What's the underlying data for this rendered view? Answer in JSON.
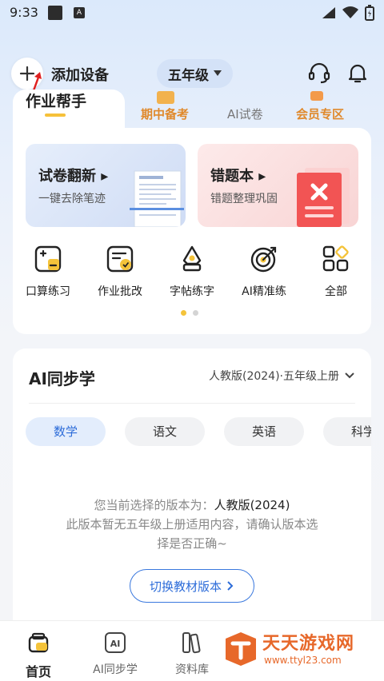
{
  "status": {
    "time": "9:33",
    "notif_letter": "A"
  },
  "header": {
    "add_label": "添加设备",
    "grade": "五年级"
  },
  "tabs": {
    "active": "作业帮手",
    "midterm": "期中备考",
    "ai_paper": "AI试卷",
    "vip": "会员专区"
  },
  "promos": [
    {
      "title": "试卷翻新",
      "subtitle": "一键去除笔迹"
    },
    {
      "title": "错题本",
      "subtitle": "错题整理巩固"
    }
  ],
  "quick": [
    {
      "label": "口算练习",
      "icon": "calc-icon"
    },
    {
      "label": "作业批改",
      "icon": "homework-check-icon"
    },
    {
      "label": "字帖练字",
      "icon": "brush-icon"
    },
    {
      "label": "AI精准练",
      "icon": "target-icon"
    },
    {
      "label": "全部",
      "icon": "all-grid-icon"
    }
  ],
  "sync": {
    "title": "AI同步学",
    "edition": "人教版(2024)·五年级上册",
    "subjects": [
      "数学",
      "语文",
      "英语",
      "科学"
    ],
    "notice_prefix": "您当前选择的版本为：",
    "notice_edition": "人教版(2024)",
    "notice_line2": "此版本暂无五年级上册适用内容，请确认版本选",
    "notice_line3": "择是否正确~",
    "switch_label": "切换教材版本"
  },
  "nav": [
    {
      "label": "首页",
      "active": true
    },
    {
      "label": "AI同步学",
      "active": false
    },
    {
      "label": "资料库",
      "active": false
    }
  ],
  "watermark": {
    "line1": "天天游戏网",
    "line2": "www.ttyl23.com"
  },
  "colors": {
    "accent_blue": "#2e6dd9",
    "accent_yellow": "#f4c33a",
    "orange": "#e0892b"
  }
}
